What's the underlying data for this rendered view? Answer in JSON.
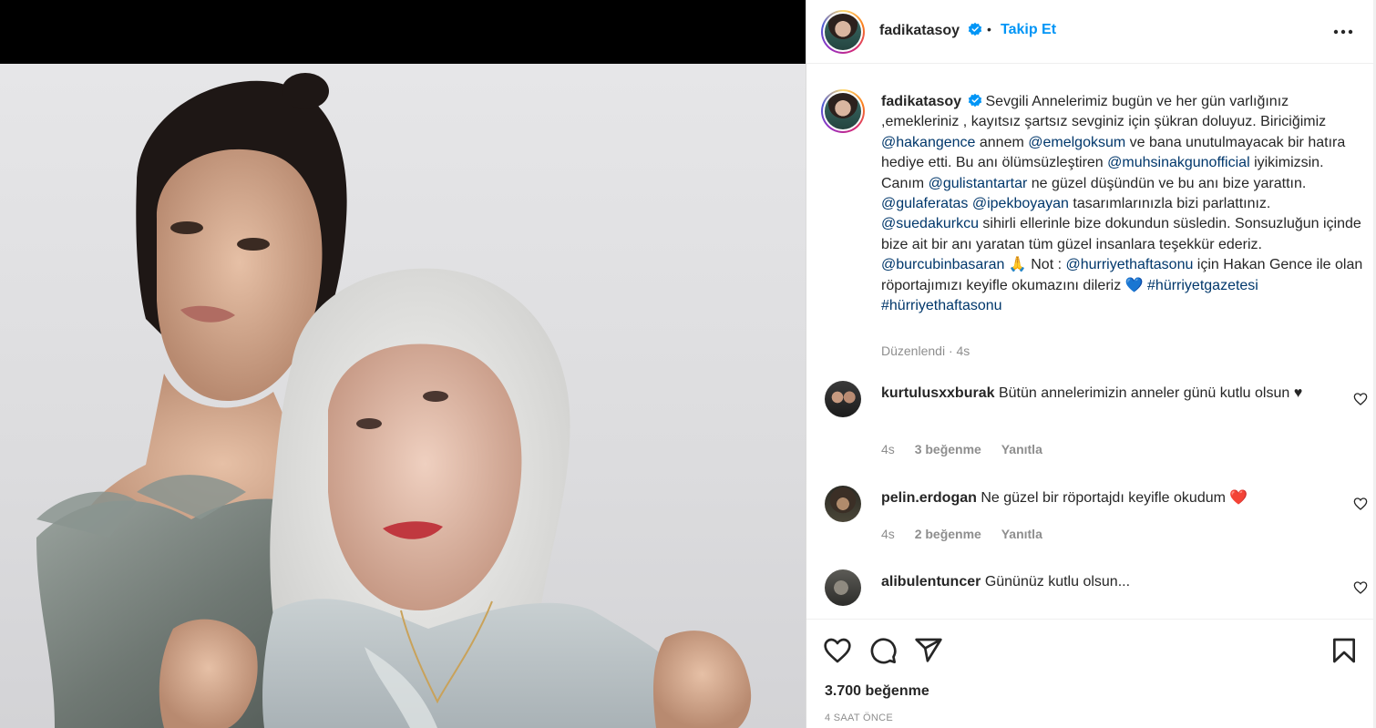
{
  "post": {
    "username": "fadikatasoy",
    "separator": "•",
    "follow_label": "Takip Et",
    "more_icon": "more-horizontal-icon",
    "verified_color": "#0095f6",
    "accent_color": "#0095f6",
    "mention_color": "#00376b"
  },
  "caption": {
    "username": "fadikatasoy",
    "parts": [
      {
        "t": "text",
        "v": "Sevgili Annelerimiz bugün ve her gün varlığınız ,emekleriniz , kayıtsız şartsız sevginiz için şükran doluyuz. Biriciğimiz "
      },
      {
        "t": "mention",
        "v": "@hakangence"
      },
      {
        "t": "text",
        "v": " annem "
      },
      {
        "t": "mention",
        "v": "@emelgoksum"
      },
      {
        "t": "text",
        "v": " ve bana unutulmayacak bir hatıra hediye etti. Bu anı ölümsüzleştiren "
      },
      {
        "t": "mention",
        "v": "@muhsinakgunofficial"
      },
      {
        "t": "text",
        "v": " iyikimizsin. Canım "
      },
      {
        "t": "mention",
        "v": "@gulistantartar"
      },
      {
        "t": "text",
        "v": " ne güzel düşündün ve bu anı bize yarattın. "
      },
      {
        "t": "mention",
        "v": "@gulaferatas"
      },
      {
        "t": "text",
        "v": " "
      },
      {
        "t": "mention",
        "v": "@ipekboyayan"
      },
      {
        "t": "text",
        "v": " tasarımlarınızla bizi parlattınız. "
      },
      {
        "t": "mention",
        "v": "@suedakurkcu"
      },
      {
        "t": "text",
        "v": " sihirli ellerinle bize dokundun süsledin. Sonsuzluğun içinde bize ait bir anı yaratan tüm güzel insanlara teşekkür ederiz. "
      },
      {
        "t": "mention",
        "v": "@burcubinbasaran"
      },
      {
        "t": "text",
        "v": " 🙏 Not : "
      },
      {
        "t": "mention",
        "v": "@hurriyethaftasonu"
      },
      {
        "t": "text",
        "v": " için Hakan Gence ile olan röportajımızı keyifle okumazını dileriz 💙 "
      },
      {
        "t": "mention",
        "v": "#hürriyetgazetesi"
      },
      {
        "t": "text",
        "v": " "
      },
      {
        "t": "mention",
        "v": "#hürriyethaftasonu"
      }
    ],
    "meta": "Düzenlendi · 4s"
  },
  "comments": [
    {
      "username": "kurtulusxxburak",
      "text": "Bütün annelerimizin anneler günü kutlu olsun ♥",
      "time": "4s",
      "likes": "3 beğenme",
      "reply": "Yanıtla"
    },
    {
      "username": "pelin.erdogan",
      "text": "Ne güzel bir röportajdı keyifle okudum ❤️",
      "time": "4s",
      "likes": "2 beğenme",
      "reply": "Yanıtla"
    },
    {
      "username": "alibulentuncer",
      "text": "Gününüz kutlu olsun...",
      "time": "",
      "likes": "",
      "reply": ""
    }
  ],
  "actions": {
    "icons": [
      "heart-icon",
      "comment-icon",
      "share-icon",
      "bookmark-icon"
    ],
    "likes": "3.700 beğenme",
    "time": "4 SAAT ÖNCE"
  }
}
